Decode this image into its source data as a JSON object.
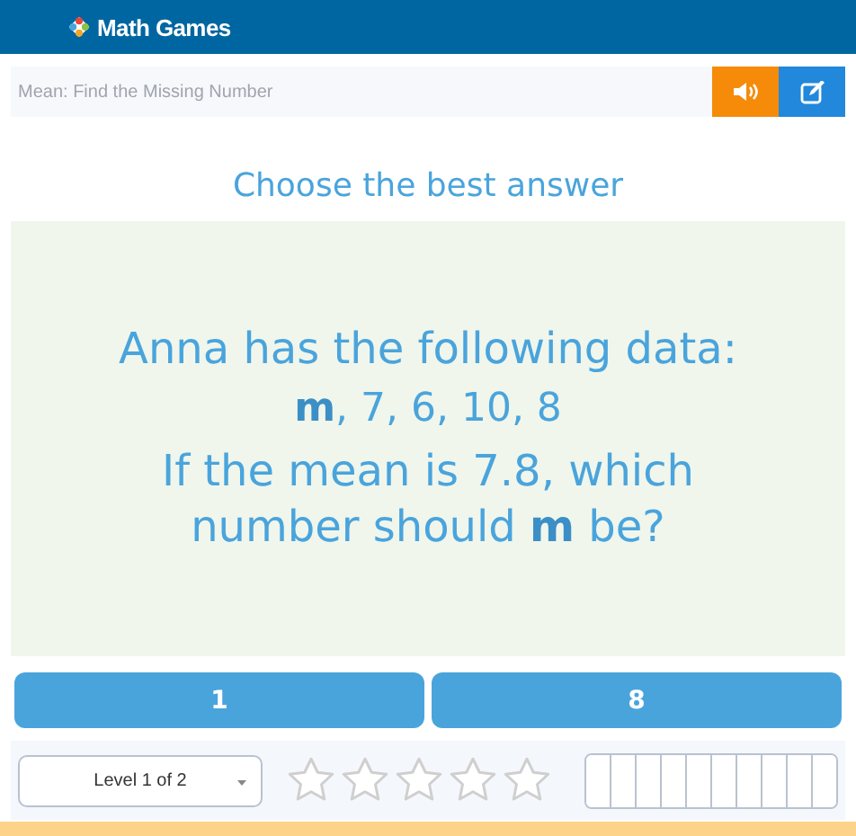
{
  "header": {
    "logo": "Math Games"
  },
  "topic": {
    "title": "Mean: Find the Missing Number"
  },
  "prompt": "Choose the best answer",
  "question": {
    "lines": [
      "Anna has the following data:",
      "**m**, 7, 6, 10, 8",
      "If the mean is 7.8, which number should **m** be?"
    ]
  },
  "answers": [
    {
      "label": "1"
    },
    {
      "label": "8"
    }
  ],
  "footer": {
    "level_select": "Level 1 of 2",
    "stars": 0,
    "progress": {
      "level": 0
    }
  }
}
